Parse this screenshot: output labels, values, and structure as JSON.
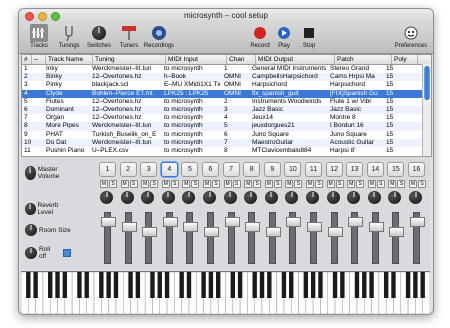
{
  "window": {
    "title": "microsynth – cool setup"
  },
  "toolbar": {
    "tracks": "Tracks",
    "tunings": "Tunings",
    "switches": "Switches",
    "tuners": "Tuners",
    "recordings": "Recordings",
    "record": "Record",
    "play": "Play",
    "stop": "Stop",
    "preferences": "Preferences"
  },
  "table": {
    "headers": [
      "#",
      "–",
      "Track Name",
      "Tuning",
      "MIDI Input",
      "Chan",
      "MIDI Output",
      "Patch",
      "Poly"
    ],
    "rows": [
      [
        "1",
        "",
        "Inky",
        "Werckmeister–III.tun",
        "to microsynth",
        "1",
        "General MIDI Instruments",
        "Stereo Grand",
        "15"
      ],
      [
        "2",
        "",
        "Binky",
        "12–Overtones.hz",
        "h–Book",
        "OMNI",
        "CampbellsHarpsichord",
        "Cams Hrpsi Ma",
        "15"
      ],
      [
        "3",
        "",
        "Pinky",
        "blackjack.scl",
        "E–MU XMidi1X1 Tx",
        "OMNI",
        "Harpsichord",
        "Harpsichord",
        "15"
      ],
      [
        "4",
        "",
        "Clyde",
        "Bohlen–Pierce ET.mt",
        "LPK25 : LPK25",
        "OMNI",
        "fix_spanish_guit",
        "[FIX]Spanish Gu",
        "15"
      ],
      [
        "5",
        "",
        "Flutes",
        "12–Overtones.hz",
        "to microsynth",
        "2",
        "Instruments Woodwinds",
        "Flute 1 w/ Vibr",
        "15"
      ],
      [
        "6",
        "",
        "Dominant",
        "12–Overtones.hz",
        "to microsynth",
        "3",
        "Jazz Basic",
        "Jazz Basic",
        "15"
      ],
      [
        "7",
        "",
        "Organ",
        "12–Overtones.hz",
        "to microsynth",
        "4",
        "Jeux14",
        "Montre 8",
        "15"
      ],
      [
        "8",
        "",
        "More Pipes",
        "Werckmeister–III.tun",
        "to microsynth",
        "5",
        "jeuxdorgues21",
        "I Bordun 16",
        "15"
      ],
      [
        "9",
        "",
        "PHAT",
        "Turkish_Buselik_on_E",
        "to microsynth",
        "6",
        "Juno Square",
        "Juno Square",
        "15"
      ],
      [
        "10",
        "",
        "Do Dat",
        "Werckmeister–III.tun",
        "to microsynth",
        "7",
        "MaestroGuitar",
        "Acoustic Guitar",
        "15"
      ],
      [
        "11",
        "",
        "Pushin Piano",
        "U–PLEX.csv",
        "to microsynth",
        "8",
        "MTClavicembalo884",
        "Harpsi 8'",
        "15"
      ]
    ],
    "selected_row": 3
  },
  "mixer": {
    "master_volume": "Master Volume",
    "reverb_level": "Reverb Level",
    "room_size": "Room Size",
    "roll_off": "Roll off",
    "channels": [
      "1",
      "2",
      "3",
      "4",
      "5",
      "6",
      "7",
      "8",
      "9",
      "10",
      "11",
      "12",
      "13",
      "14",
      "15",
      "16"
    ],
    "selected_channel": "4",
    "mute_label": "M",
    "solo_label": "S"
  }
}
